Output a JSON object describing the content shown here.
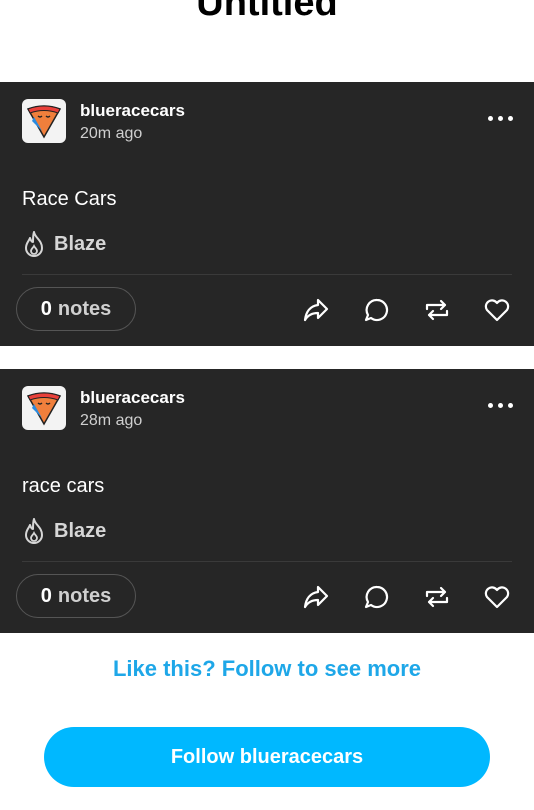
{
  "page": {
    "title": "Untitled"
  },
  "posts": [
    {
      "username": "blueracecars",
      "time": "20m ago",
      "text": "Race Cars",
      "blaze_label": "Blaze",
      "notes_count": "0",
      "notes_label": "notes"
    },
    {
      "username": "blueracecars",
      "time": "28m ago",
      "text": "race cars",
      "blaze_label": "Blaze",
      "notes_count": "0",
      "notes_label": "notes"
    }
  ],
  "footer": {
    "prompt": "Like this? Follow to see more",
    "follow_button": "Follow blueracecars"
  },
  "colors": {
    "post_bg": "#262626",
    "accent": "#00b8ff",
    "link": "#1ea7e8"
  },
  "icons": {
    "avatar": "pizza-avatar-icon",
    "more": "more-options-icon",
    "blaze": "flame-icon",
    "share": "share-icon",
    "reply": "reply-icon",
    "reblog": "reblog-icon",
    "like": "heart-icon"
  }
}
